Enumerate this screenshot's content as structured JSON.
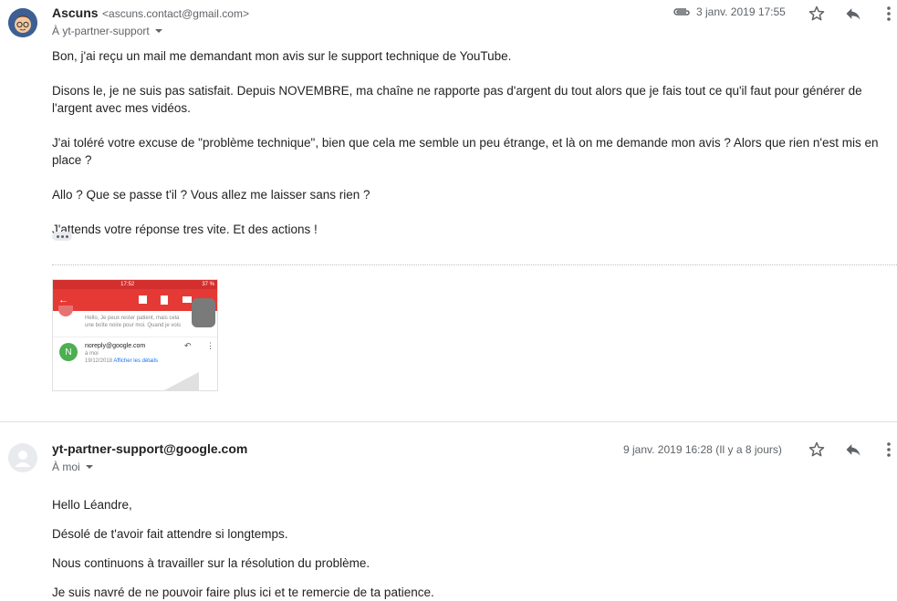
{
  "message1": {
    "sender_name": "Ascuns",
    "sender_email": "<ascuns.contact@gmail.com>",
    "recipient": "À yt-partner-support",
    "date": "3 janv. 2019 17:55",
    "body": [
      "Bon, j'ai reçu un mail me demandant mon avis sur le support technique de YouTube.",
      "Disons le, je ne suis pas satisfait. Depuis NOVEMBRE, ma chaîne ne rapporte pas d'argent du tout alors que je fais tout ce qu'il faut pour générer de l'argent avec mes vidéos.",
      "J'ai toléré votre excuse de \"problème technique\", bien que cela me semble un peu étrange, et là on me demande mon avis ? Alors que rien n'est mis en place ?",
      "Allo ? Que se passe t'il ? Vous allez me laisser sans rien ?",
      "J'attends votre réponse tres vite. Et des actions !"
    ],
    "attachment": {
      "status_time": "17:52",
      "status_battery": "37 %",
      "preview_line1": "Hello, Je peux rester patient, mais cela",
      "preview_line2": "une boîte noire pour moi. Quand je vois",
      "initial": "N",
      "email": "noreply@google.com",
      "to": "à moi",
      "date": "19/12/2018",
      "details_link": "Afficher les détails"
    }
  },
  "message2": {
    "sender_name": "yt-partner-support@google.com",
    "recipient": "À moi",
    "date": "9 janv. 2019 16:28 (Il y a 8 jours)",
    "body": [
      "Hello Léandre,",
      "Désolé de t'avoir fait attendre si longtemps.",
      "Nous continuons à travailler sur la résolution du problème.",
      "Je suis navré de ne pouvoir faire plus ici et te remercie de ta patience."
    ]
  },
  "colors": {
    "accent_red": "#e53935",
    "attachment_green": "#4caf50",
    "link_blue": "#1a73e8"
  },
  "icons": [
    "avatar",
    "paperclip-icon",
    "star-icon",
    "reply-icon",
    "more-vert-icon",
    "chevron-down-icon",
    "default-avatar"
  ]
}
